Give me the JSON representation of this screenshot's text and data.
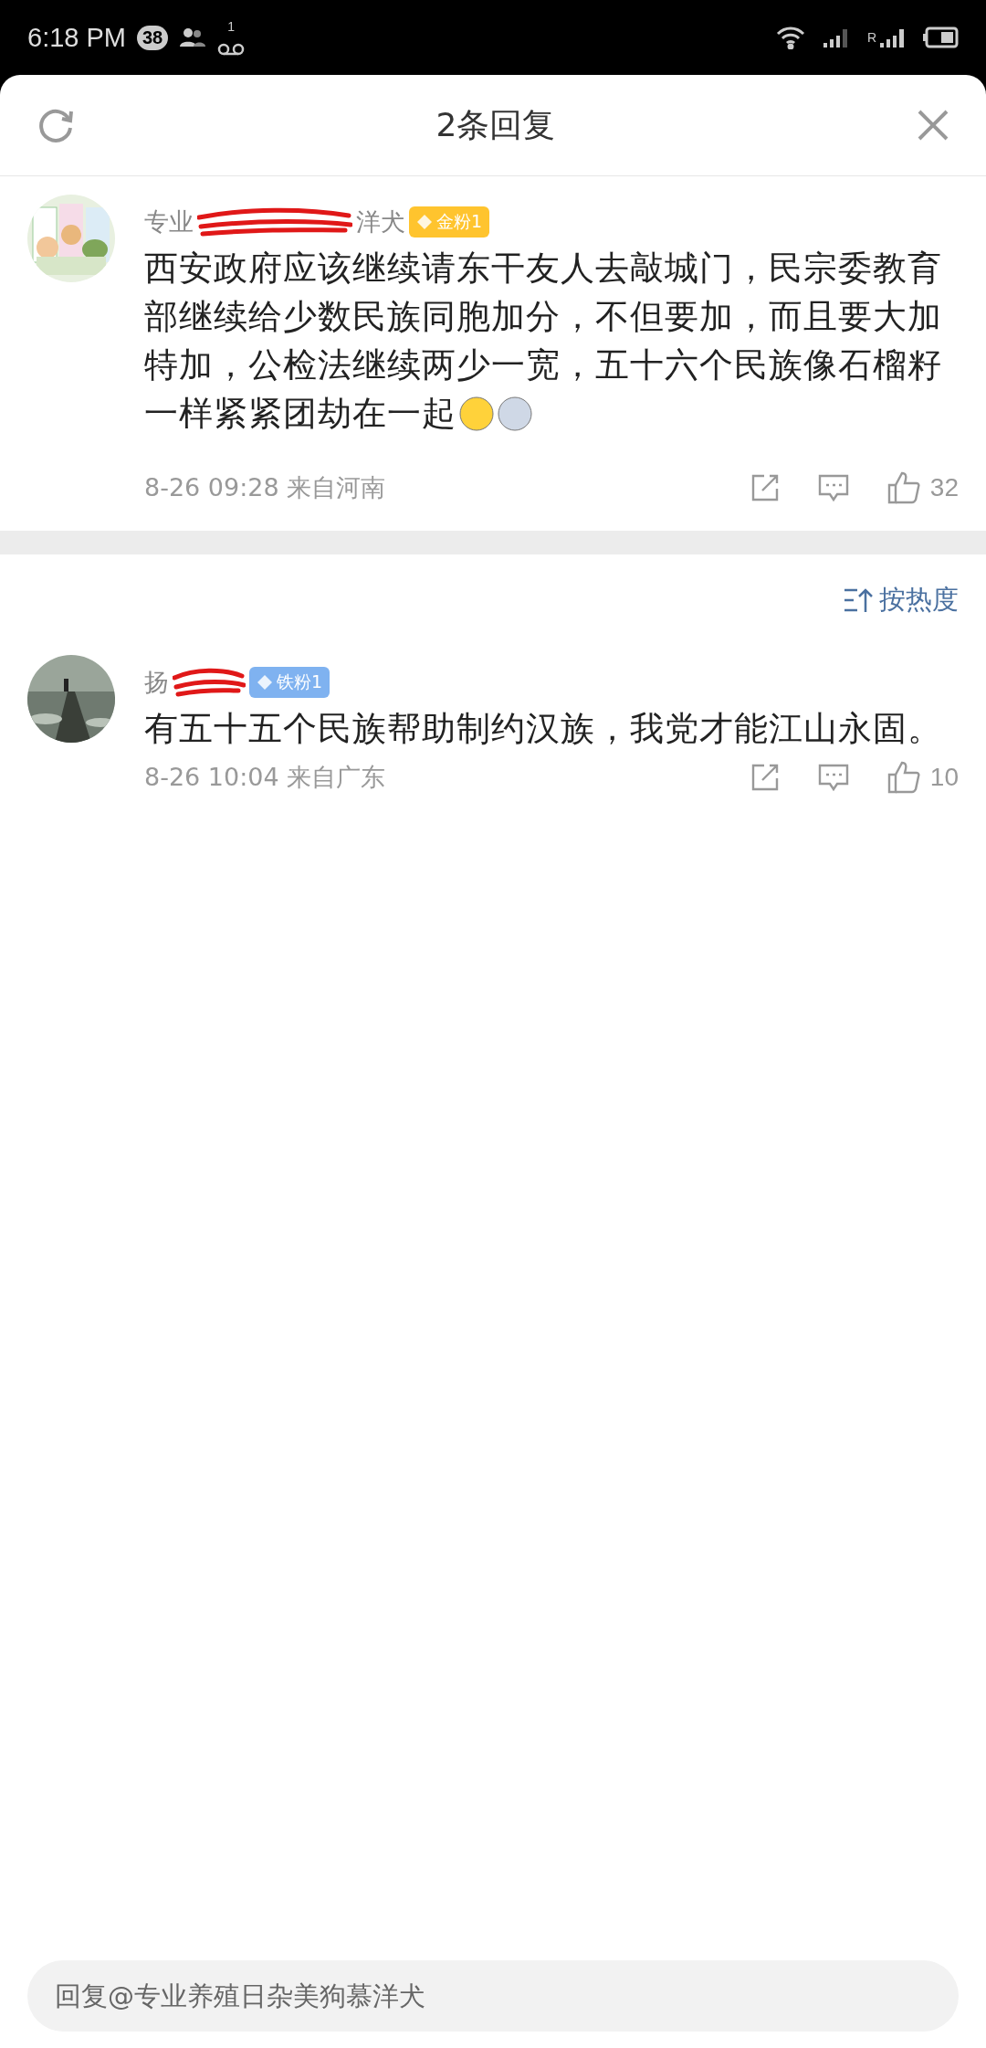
{
  "status_bar": {
    "time": "6:18 PM",
    "badge": "38",
    "voicemail_count": "1",
    "sim2_label": "R"
  },
  "sheet": {
    "title": "2条回复"
  },
  "comments": [
    {
      "name": "专业",
      "name_tail": "洋犬",
      "fan_badge": {
        "label": "金粉1",
        "color": "#ffc42e"
      },
      "text": "西安政府应该继续请东干友人去敲城门，民宗委教育部继续给少数民族同胞加分，不但要加，而且要大加特加，公检法继续两少一宽，五十六个民族像石榴籽一样紧紧团劫在一起",
      "emojis": [
        {
          "kind": "smile"
        },
        {
          "kind": "dog"
        }
      ],
      "time": "8-26 09:28",
      "location": "来自河南",
      "likes": "32"
    },
    {
      "name": "扬",
      "fan_badge": {
        "label": "铁粉1",
        "color": "#7fb2f0"
      },
      "text": "有五十五个民族帮助制约汉族，我党才能江山永固。",
      "time": "8-26 10:04",
      "location": "来自广东",
      "likes": "10",
      "sort_label": "按热度"
    }
  ],
  "reply_box": {
    "placeholder": "回复@专业养殖日杂美狗慕洋犬"
  }
}
